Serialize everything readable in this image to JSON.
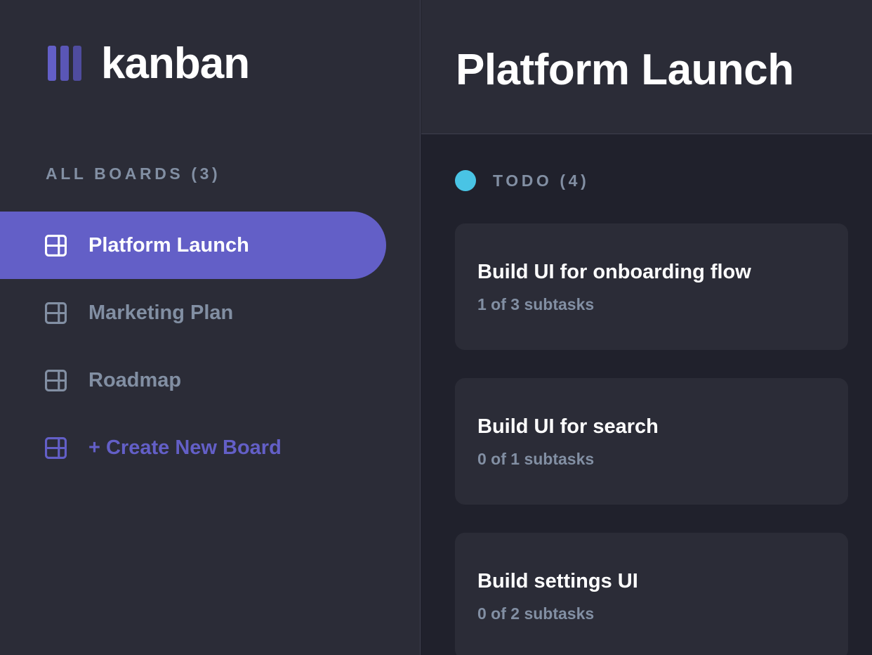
{
  "brand": {
    "name": "kanban",
    "bar_colors": [
      "#635fc7",
      "#5a56b6",
      "#4f4c9e"
    ]
  },
  "sidebar": {
    "heading": "ALL BOARDS (3)",
    "boards": [
      {
        "label": "Platform Launch",
        "icon": "board-icon",
        "active": true
      },
      {
        "label": "Marketing Plan",
        "icon": "board-icon",
        "active": false
      },
      {
        "label": "Roadmap",
        "icon": "board-icon",
        "active": false
      }
    ],
    "create_label": "+ Create New Board"
  },
  "header": {
    "title": "Platform Launch"
  },
  "columns": [
    {
      "title": "TODO (4)",
      "dot_color": "#49c4e5",
      "tasks": [
        {
          "title": "Build UI for onboarding flow",
          "subtasks": "1 of 3 subtasks"
        },
        {
          "title": "Build UI for search",
          "subtasks": "0 of 1 subtasks"
        },
        {
          "title": "Build settings UI",
          "subtasks": "0 of 2 subtasks"
        }
      ]
    }
  ],
  "colors": {
    "accent": "#635fc7",
    "sidebar_bg": "#2b2c37",
    "board_bg": "#20212c",
    "muted_text": "#828fa3",
    "divider": "#3e3f4e"
  }
}
